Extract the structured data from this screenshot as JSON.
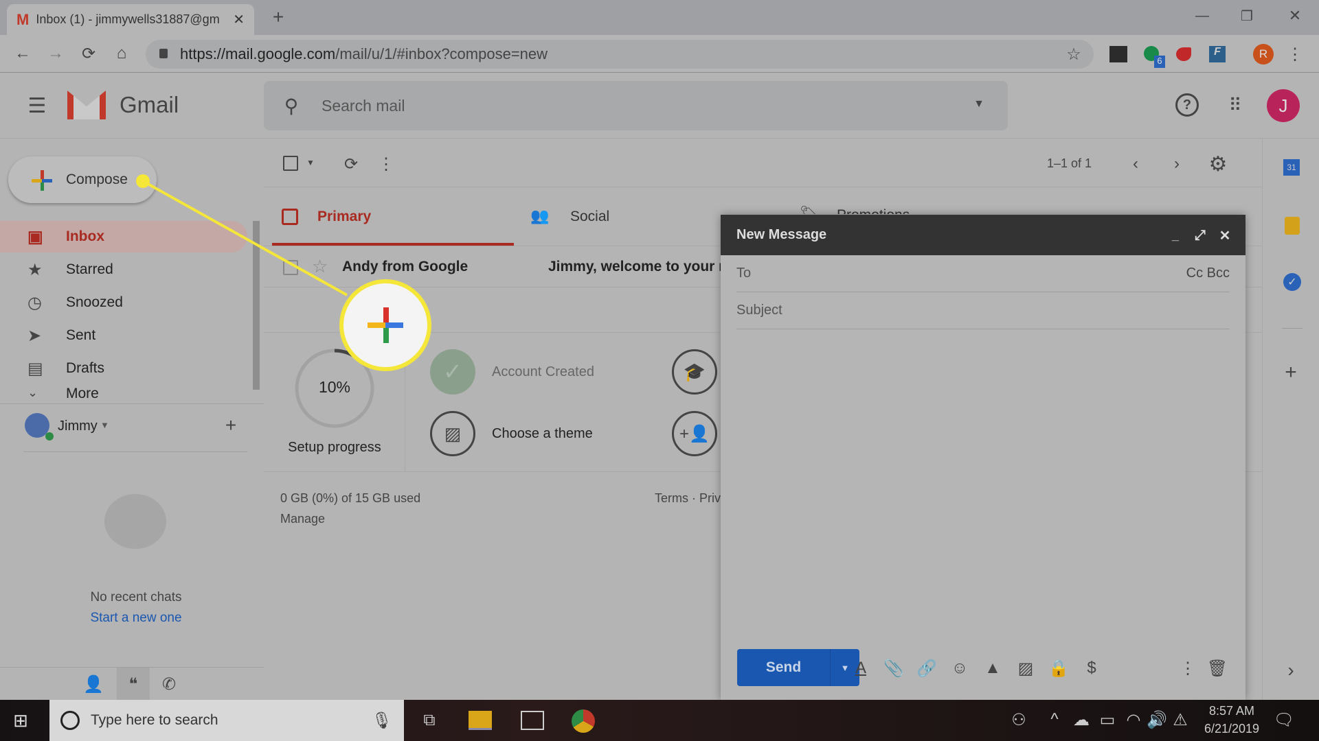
{
  "browser": {
    "tab_title": "Inbox (1) - jimmywells31887@gm",
    "url_host": "https://mail.google.com",
    "url_path": "/mail/u/1/#inbox?compose=new",
    "ext_badge": "6",
    "profile_initial": "R"
  },
  "gmail": {
    "logo_text": "Gmail",
    "search_placeholder": "Search mail",
    "avatar_initial": "J",
    "compose_label": "Compose"
  },
  "sidebar": {
    "items": [
      {
        "label": "Inbox",
        "icon": "inbox-icon",
        "active": true
      },
      {
        "label": "Starred",
        "icon": "star-icon"
      },
      {
        "label": "Snoozed",
        "icon": "clock-icon"
      },
      {
        "label": "Sent",
        "icon": "send-icon"
      },
      {
        "label": "Drafts",
        "icon": "draft-icon"
      },
      {
        "label": "More",
        "icon": "chevron-down-icon"
      }
    ],
    "hangouts_user": "Jimmy",
    "no_chats": "No recent chats",
    "start_new": "Start a new one"
  },
  "toolbar": {
    "pagination": "1–1 of 1"
  },
  "tabs": [
    {
      "label": "Primary",
      "active": true
    },
    {
      "label": "Social"
    },
    {
      "label": "Promotions"
    }
  ],
  "emails": [
    {
      "sender": "Andy from Google",
      "subject": "Jimmy, welcome to your n"
    }
  ],
  "setup": {
    "progress_percent": 10,
    "progress_text": "10%",
    "progress_label": "Setup progress",
    "steps": [
      {
        "label": "Account Created",
        "done": true
      },
      {
        "label": "Choose a theme",
        "done": false
      }
    ]
  },
  "footer": {
    "storage": "0 GB (0%) of 15 GB used",
    "manage": "Manage",
    "terms": "Terms · Priv"
  },
  "compose": {
    "title": "New Message",
    "to_label": "To",
    "cc_bcc": "Cc Bcc",
    "subject_placeholder": "Subject",
    "send_label": "Send"
  },
  "taskbar": {
    "search_placeholder": "Type here to search",
    "time": "8:57 AM",
    "date": "6/21/2019"
  },
  "colors": {
    "highlight": "#f5e63a",
    "send": "#1a57b0",
    "accent_red": "#b3261e"
  }
}
